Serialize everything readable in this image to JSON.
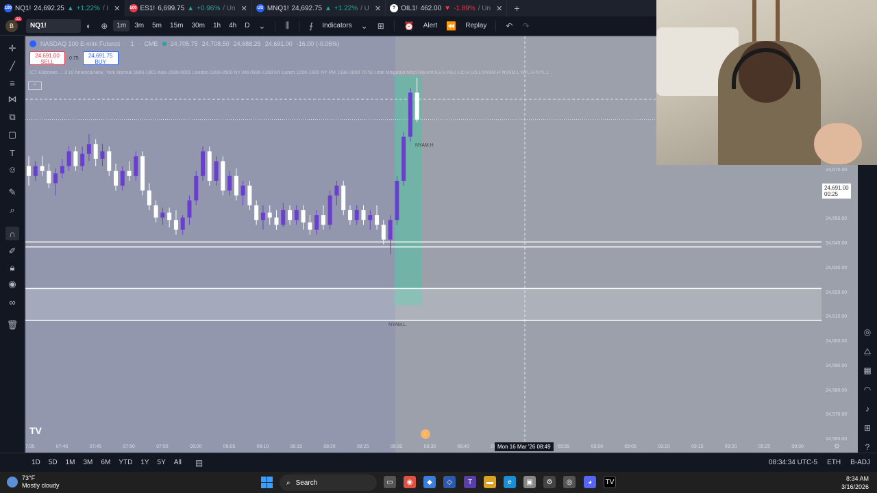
{
  "tabs": [
    {
      "symbol": "NQ1!",
      "price": "24,692.25",
      "change": "+1.22%",
      "dir": "up",
      "tail": "/ I",
      "badge_color": "#2962ff",
      "badge": "100"
    },
    {
      "symbol": "ES1!",
      "price": "6,699.75",
      "change": "+0.96%",
      "dir": "up",
      "tail": "/ Un",
      "badge_color": "#f23645",
      "badge": "500"
    },
    {
      "symbol": "MNQ1!",
      "price": "24,692.75",
      "change": "+1.22%",
      "dir": "up",
      "tail": "/ U",
      "badge_color": "#2962ff",
      "badge": "US"
    },
    {
      "symbol": "OIL1!",
      "price": "462.00",
      "change": "-1.89%",
      "dir": "dn",
      "tail": "/ Un",
      "badge_color": "#ffffff",
      "badge": "?"
    }
  ],
  "toolbar": {
    "avatar": "B",
    "notif": "12",
    "symbol": "NQ1!",
    "intervals": [
      "1m",
      "3m",
      "5m",
      "15m",
      "30m",
      "1h",
      "4h",
      "D"
    ],
    "selected_interval": "1m",
    "indicators": "Indicators",
    "alert": "Alert",
    "replay": "Replay"
  },
  "legend": {
    "title": "NASDAQ 100 E-mini Futures",
    "interval": "1",
    "exchange": "CME",
    "open": "24,705.75",
    "high": "24,708.50",
    "low": "24,688.25",
    "close": "24,691.00",
    "change": "-16.00 (-0.06%)"
  },
  "trade": {
    "sell_price": "24,691.00",
    "sell_label": "SELL",
    "spread": "0.75",
    "buy_price": "24,691.75",
    "buy_label": "BUY"
  },
  "indicator_line": "ICT Killzones ... 3 10 America/New_York Normal 1800-1801 Asia 2000-0000 London 0200-0500 NY AM 0930-1100 NY Lunch 1200-1300 NY PM 1330-1600 70 50 Until Mitigated Most Recent AS.H AS.L LO.H LO.L NYAM.H NYAM.L NYL.H NYL.L",
  "chart_labels": {
    "high_label": "NYAM.H",
    "low_label": "NYAM.L",
    "last_price": "24,691.00",
    "countdown": "00:25",
    "crosshair_time": "Mon 16 Mar '26   08:49"
  },
  "y_axis": [
    "24,700.00",
    "24,690.00",
    "24,680.00",
    "24,670.00",
    "24,660.00",
    "24,650.00",
    "24,640.00",
    "24,630.00",
    "24,620.00",
    "24,610.00",
    "24,600.00",
    "24,590.00",
    "24,580.00",
    "24,570.00",
    "24,560.00"
  ],
  "x_axis": [
    "07:35",
    "07:40",
    "07:45",
    "07:50",
    "07:55",
    "08:00",
    "08:05",
    "08:10",
    "08:15",
    "08:20",
    "08:25",
    "08:30",
    "08:35",
    "08:40",
    "08:45",
    "08:50",
    "08:55",
    "09:00",
    "09:05",
    "09:10",
    "09:15",
    "09:20",
    "09:25",
    "09:30"
  ],
  "bottom": {
    "ranges": [
      "1D",
      "5D",
      "1M",
      "3M",
      "6M",
      "YTD",
      "1Y",
      "5Y",
      "All"
    ],
    "time": "08:34:34 UTC-5",
    "session": "ETH",
    "adj": "B-ADJ"
  },
  "taskbar": {
    "temp": "73°F",
    "weather": "Mostly cloudy",
    "search": "Search",
    "time": "8:34 AM",
    "date": "3/16/2026"
  },
  "chart_data": {
    "type": "candlestick",
    "x": [
      "07:33",
      "07:34",
      "07:35",
      "07:36",
      "07:37",
      "07:38",
      "07:39",
      "07:40",
      "07:41",
      "07:42",
      "07:43",
      "07:44",
      "07:45",
      "07:46",
      "07:47",
      "07:48",
      "07:49",
      "07:50",
      "07:51",
      "07:52",
      "07:53",
      "07:54",
      "07:55",
      "07:56",
      "07:57",
      "07:58",
      "07:59",
      "08:00",
      "08:01",
      "08:02",
      "08:03",
      "08:04",
      "08:05",
      "08:06",
      "08:07",
      "08:08",
      "08:09",
      "08:10",
      "08:11",
      "08:12",
      "08:13",
      "08:14",
      "08:15",
      "08:16",
      "08:17",
      "08:18",
      "08:19",
      "08:20",
      "08:21",
      "08:22",
      "08:23",
      "08:24",
      "08:25",
      "08:26",
      "08:27",
      "08:28",
      "08:29",
      "08:30",
      "08:31",
      "08:32",
      "08:33",
      "08:34"
    ],
    "ohlc": [
      [
        24672,
        24676,
        24664,
        24668
      ],
      [
        24668,
        24674,
        24666,
        24672
      ],
      [
        24672,
        24676,
        24668,
        24670
      ],
      [
        24670,
        24673,
        24663,
        24665
      ],
      [
        24665,
        24671,
        24660,
        24669
      ],
      [
        24669,
        24675,
        24667,
        24672
      ],
      [
        24672,
        24680,
        24670,
        24678
      ],
      [
        24678,
        24680,
        24670,
        24672
      ],
      [
        24672,
        24680,
        24670,
        24677
      ],
      [
        24677,
        24685,
        24674,
        24681
      ],
      [
        24681,
        24683,
        24672,
        24675
      ],
      [
        24675,
        24681,
        24672,
        24678
      ],
      [
        24678,
        24680,
        24668,
        24670
      ],
      [
        24670,
        24673,
        24662,
        24664
      ],
      [
        24664,
        24672,
        24662,
        24670
      ],
      [
        24670,
        24674,
        24666,
        24668
      ],
      [
        24668,
        24678,
        24666,
        24676
      ],
      [
        24676,
        24678,
        24660,
        24662
      ],
      [
        24662,
        24665,
        24654,
        24656
      ],
      [
        24656,
        24658,
        24649,
        24651
      ],
      [
        24651,
        24655,
        24648,
        24653
      ],
      [
        24653,
        24655,
        24647,
        24650
      ],
      [
        24650,
        24654,
        24644,
        24646
      ],
      [
        24646,
        24652,
        24644,
        24651
      ],
      [
        24651,
        24660,
        24648,
        24658
      ],
      [
        24658,
        24670,
        24656,
        24668
      ],
      [
        24668,
        24680,
        24666,
        24678
      ],
      [
        24678,
        24680,
        24664,
        24666
      ],
      [
        24666,
        24676,
        24664,
        24674
      ],
      [
        24674,
        24676,
        24660,
        24662
      ],
      [
        24662,
        24670,
        24660,
        24668
      ],
      [
        24668,
        24671,
        24658,
        24660
      ],
      [
        24660,
        24666,
        24656,
        24664
      ],
      [
        24664,
        24666,
        24654,
        24656
      ],
      [
        24656,
        24658,
        24648,
        24650
      ],
      [
        24650,
        24656,
        24646,
        24653
      ],
      [
        24653,
        24656,
        24648,
        24651
      ],
      [
        24651,
        24654,
        24646,
        24648
      ],
      [
        24648,
        24657,
        24647,
        24654
      ],
      [
        24654,
        24656,
        24648,
        24650
      ],
      [
        24650,
        24656,
        24648,
        24654
      ],
      [
        24654,
        24656,
        24646,
        24649
      ],
      [
        24649,
        24652,
        24644,
        24646
      ],
      [
        24646,
        24654,
        24644,
        24652
      ],
      [
        24652,
        24656,
        24646,
        24648
      ],
      [
        24648,
        24662,
        24646,
        24660
      ],
      [
        24660,
        24666,
        24656,
        24664
      ],
      [
        24664,
        24666,
        24652,
        24654
      ],
      [
        24654,
        24656,
        24648,
        24650
      ],
      [
        24650,
        24656,
        24648,
        24654
      ],
      [
        24654,
        24656,
        24648,
        24650
      ],
      [
        24650,
        24654,
        24646,
        24652
      ],
      [
        24652,
        24656,
        24646,
        24648
      ],
      [
        24648,
        24650,
        24640,
        24642
      ],
      [
        24642,
        24652,
        24636,
        24650
      ],
      [
        24650,
        24668,
        24648,
        24666
      ],
      [
        24666,
        24686,
        24664,
        24684
      ],
      [
        24684,
        24704,
        24682,
        24702
      ],
      [
        24702,
        24708,
        24690,
        24691
      ]
    ],
    "ylim": [
      24555,
      24725
    ]
  },
  "colors": {
    "chart_bg": "#9ca0aa",
    "bull": "#6a3fd0",
    "bear": "#ffffff",
    "killzone": "#4fc2a4",
    "session_shade": "#8a90b0"
  }
}
